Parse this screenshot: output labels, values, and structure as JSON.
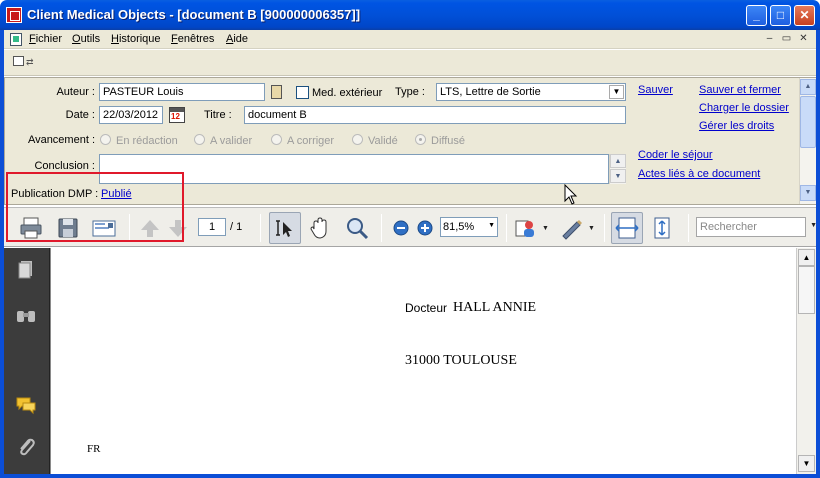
{
  "window": {
    "title": "Client Medical Objects - [document B [900000006357]]",
    "controls": {
      "minimize": "_",
      "maximize": "□",
      "close": "✕"
    }
  },
  "menu": {
    "items": [
      "Fichier",
      "Outils",
      "Historique",
      "Fenêtres",
      "Aide"
    ],
    "mdi_controls": [
      "–",
      "▭",
      "✕"
    ]
  },
  "form": {
    "author_label": "Auteur :",
    "author_value": "PASTEUR Louis",
    "med_ext_label": "Med. extérieur",
    "type_label": "Type :",
    "type_value": "LTS, Lettre de Sortie",
    "date_label": "Date :",
    "date_value": "22/03/2012",
    "calendar_badge": "12",
    "title_label": "Titre :",
    "title_value": "document B",
    "progress_label": "Avancement :",
    "progress_options": [
      "En rédaction",
      "A valider",
      "A corriger",
      "Validé",
      "Diffusé"
    ],
    "progress_selected": "Diffusé",
    "conclusion_label": "Conclusion :",
    "conclusion_value": "",
    "dmp_label": "Publication DMP :",
    "dmp_value": "Publié"
  },
  "actions": {
    "save": "Sauver",
    "save_close": "Sauver et fermer",
    "load_folder": "Charger le dossier",
    "manage_rights": "Gérer les droits",
    "code_stay": "Coder le séjour",
    "linked_acts": "Actes liés à ce document"
  },
  "viewer": {
    "page_current": "1",
    "page_total": "/ 1",
    "zoom": "81,5%",
    "search_placeholder": "Rechercher"
  },
  "document": {
    "line1_prefix": "Docteur",
    "line1_name": "HALL ANNIE",
    "line2": "31000 TOULOUSE",
    "line3": "FR"
  },
  "colors": {
    "title_bar": "#0054e3",
    "highlight_box": "#e0192b",
    "link": "#0000cc",
    "panel": "#ece9d8",
    "nav_panel": "#3c3c3c"
  }
}
